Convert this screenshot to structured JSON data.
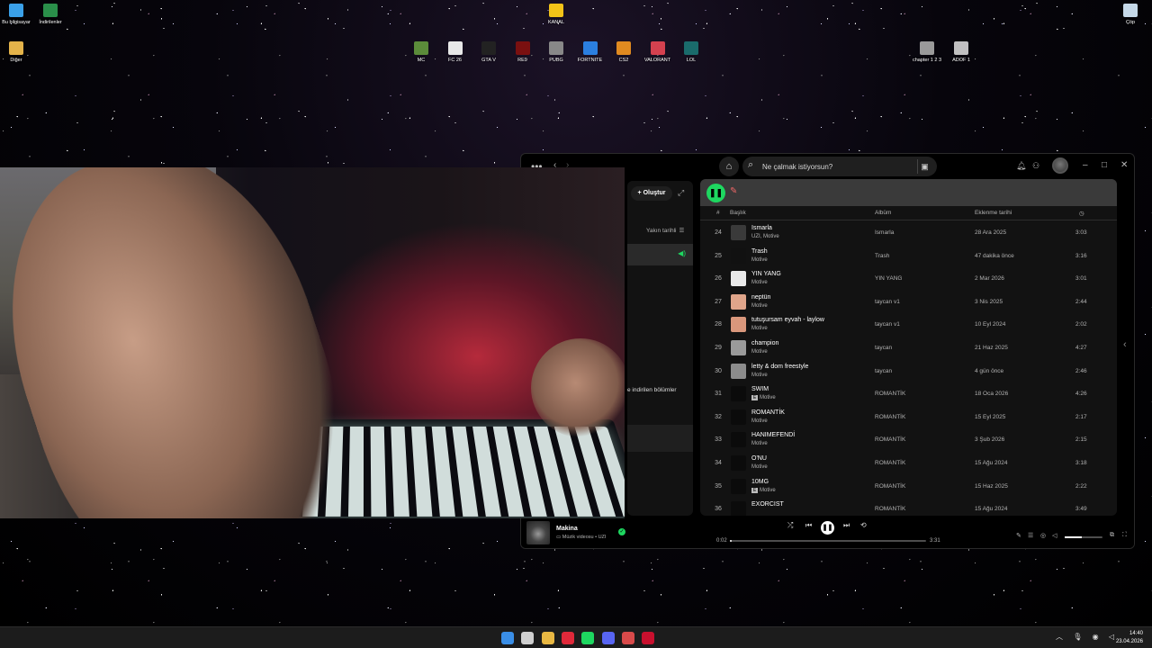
{
  "desktop": {
    "icons_left": [
      {
        "label": "Bu bilgisayar",
        "color": "#3aa0e8"
      },
      {
        "label": "İndirilenler",
        "color": "#2a8f4a"
      },
      {
        "label": "Diğer",
        "color": "#e4b34a"
      }
    ],
    "kanal": {
      "label": "KANAL",
      "color": "#f2c318"
    },
    "games": [
      {
        "label": "MC",
        "color": "#5b8c3a"
      },
      {
        "label": "FC 26",
        "color": "#e8e8e8"
      },
      {
        "label": "GTA V",
        "color": "#222222"
      },
      {
        "label": "RE9",
        "color": "#7a1010"
      },
      {
        "label": "PUBG",
        "color": "#888888"
      },
      {
        "label": "FORTNITE",
        "color": "#2b7fe0"
      },
      {
        "label": "CS2",
        "color": "#e08a20"
      },
      {
        "label": "VALORANT",
        "color": "#d4414f"
      },
      {
        "label": "LOL",
        "color": "#1a6b6b"
      }
    ],
    "right_icons": [
      {
        "label": "chapter 1 2 3",
        "color": "#9a9a9a"
      },
      {
        "label": "ADOF 1",
        "color": "#c0c0c0"
      }
    ],
    "recycle": {
      "label": "Çöp",
      "color": "#c5d8e8"
    }
  },
  "spotify": {
    "search_placeholder": "Ne çalmak istiyorsun?",
    "sidebar": {
      "create_label": "Oluştur",
      "sort_label": "Yakın tarihli",
      "downloaded_label": "e indirilen bölümler"
    },
    "columns": {
      "num": "#",
      "title": "Başlık",
      "album": "Albüm",
      "added": "Eklenme tarihi"
    },
    "tracks": [
      {
        "num": "24",
        "title": "Ismarla",
        "artist": "UZI, Motive",
        "explicit": false,
        "album": "Ismarla",
        "added": "28 Ara 2025",
        "duration": "3:03",
        "art": "#3a3a3a"
      },
      {
        "num": "25",
        "title": "Trash",
        "artist": "Motive",
        "explicit": false,
        "album": "Trash",
        "added": "47 dakika önce",
        "duration": "3:16",
        "art": "#111111"
      },
      {
        "num": "26",
        "title": "YIN YANG",
        "artist": "Motive",
        "explicit": false,
        "album": "YIN YANG",
        "added": "2 Mar 2026",
        "duration": "3:01",
        "art": "#e9e9e9"
      },
      {
        "num": "27",
        "title": "neptün",
        "artist": "Motive",
        "explicit": false,
        "album": "taycan v1",
        "added": "3 Nis 2025",
        "duration": "2:44",
        "art": "#e0a58a"
      },
      {
        "num": "28",
        "title": "tutuşursam eyvah - laylow",
        "artist": "Motive",
        "explicit": false,
        "album": "taycan v1",
        "added": "10 Eyl 2024",
        "duration": "2:02",
        "art": "#d9977c"
      },
      {
        "num": "29",
        "title": "champion",
        "artist": "Motive",
        "explicit": false,
        "album": "taycan",
        "added": "21 Haz 2025",
        "duration": "4:27",
        "art": "#9a9a9a"
      },
      {
        "num": "30",
        "title": "letty & dom freestyle",
        "artist": "Motive",
        "explicit": false,
        "album": "taycan",
        "added": "4 gün önce",
        "duration": "2:46",
        "art": "#8c8c8c"
      },
      {
        "num": "31",
        "title": "SWIM",
        "artist": "Motive",
        "explicit": true,
        "album": "ROMANTİK",
        "added": "18 Oca 2026",
        "duration": "4:26",
        "art": "#0b0b0b"
      },
      {
        "num": "32",
        "title": "ROMANTİK",
        "artist": "Motive",
        "explicit": false,
        "album": "ROMANTİK",
        "added": "15 Eyl 2025",
        "duration": "2:17",
        "art": "#0b0b0b"
      },
      {
        "num": "33",
        "title": "HANIMEFENDİ",
        "artist": "Motive",
        "explicit": false,
        "album": "ROMANTİK",
        "added": "3 Şub 2026",
        "duration": "2:15",
        "art": "#0b0b0b"
      },
      {
        "num": "34",
        "title": "O'NU",
        "artist": "Motive",
        "explicit": false,
        "album": "ROMANTİK",
        "added": "15 Ağu 2024",
        "duration": "3:18",
        "art": "#0b0b0b"
      },
      {
        "num": "35",
        "title": "10MG",
        "artist": "Motive",
        "explicit": true,
        "album": "ROMANTİK",
        "added": "15 Haz 2025",
        "duration": "2:22",
        "art": "#0b0b0b"
      },
      {
        "num": "36",
        "title": "EXORCIST",
        "artist": "",
        "explicit": false,
        "album": "ROMANTİK",
        "added": "15 Ağu 2024",
        "duration": "3:49",
        "art": "#0b0b0b"
      }
    ],
    "player": {
      "title": "Makina",
      "subtitle": "Müzik videosu • UZI",
      "elapsed": "0:02",
      "total": "3:31",
      "progress": 0.01,
      "volume": 0.45
    }
  },
  "taskbar": {
    "apps": [
      {
        "name": "start",
        "color": "#3a8ee6"
      },
      {
        "name": "task-view",
        "color": "#cfcfcf"
      },
      {
        "name": "file-explorer",
        "color": "#e9b843"
      },
      {
        "name": "opera",
        "color": "#e0293a"
      },
      {
        "name": "spotify",
        "color": "#1ed760"
      },
      {
        "name": "discord",
        "color": "#5865f2"
      },
      {
        "name": "steam-like",
        "color": "#d84a4a"
      },
      {
        "name": "red-app",
        "color": "#c8102e"
      }
    ],
    "time": "14:40",
    "date": "23.04.2026"
  }
}
